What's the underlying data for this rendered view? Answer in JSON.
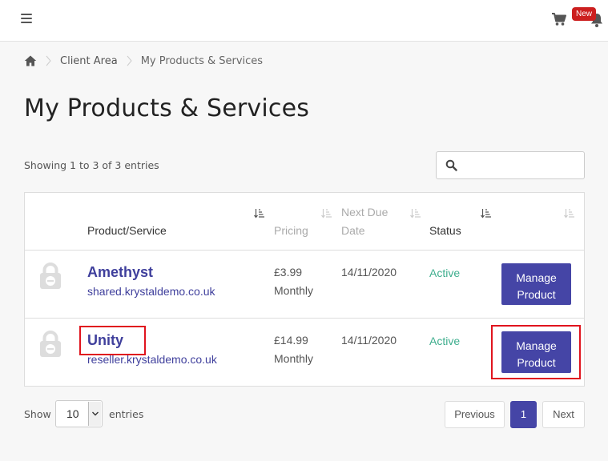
{
  "header": {
    "menu_icon": "hamburger-icon",
    "cart_icon": "cart-icon",
    "notification_icon": "bell-icon",
    "new_badge": "New"
  },
  "breadcrumb": {
    "home_icon": "home-icon",
    "items": [
      "Client Area",
      "My Products & Services"
    ]
  },
  "page": {
    "title": "My Products & Services",
    "showing": "Showing 1 to 3 of 3 entries"
  },
  "search": {
    "placeholder": "",
    "value": ""
  },
  "table": {
    "columns": [
      {
        "label": ""
      },
      {
        "label": "Product/Service"
      },
      {
        "label": "Pricing"
      },
      {
        "label": "Next Due Date",
        "line1": "Next Due",
        "line2": "Date"
      },
      {
        "label": "Status"
      },
      {
        "label": ""
      }
    ],
    "rows": [
      {
        "icon": "lock-icon",
        "name": "Amethyst",
        "domain": "shared.krystaldemo.co.uk",
        "price": "£3.99",
        "cycle": "Monthly",
        "due": "14/11/2020",
        "status": "Active",
        "button": {
          "line1": "Manage",
          "line2": "Product"
        }
      },
      {
        "icon": "lock-icon",
        "name": "Unity",
        "domain": "reseller.krystaldemo.co.uk",
        "price": "£14.99",
        "cycle": "Monthly",
        "due": "14/11/2020",
        "status": "Active",
        "button": {
          "line1": "Manage",
          "line2": "Product"
        }
      }
    ]
  },
  "footer": {
    "show_label": "Show",
    "page_size": "10",
    "entries_label": "entries",
    "pagination": {
      "previous": "Previous",
      "current": "1",
      "next": "Next"
    }
  },
  "colors": {
    "accent": "#4545a6",
    "link": "#3f3f9c",
    "status_active": "#3fae8e",
    "badge": "#cc1f1f",
    "highlight": "#e0141e"
  }
}
